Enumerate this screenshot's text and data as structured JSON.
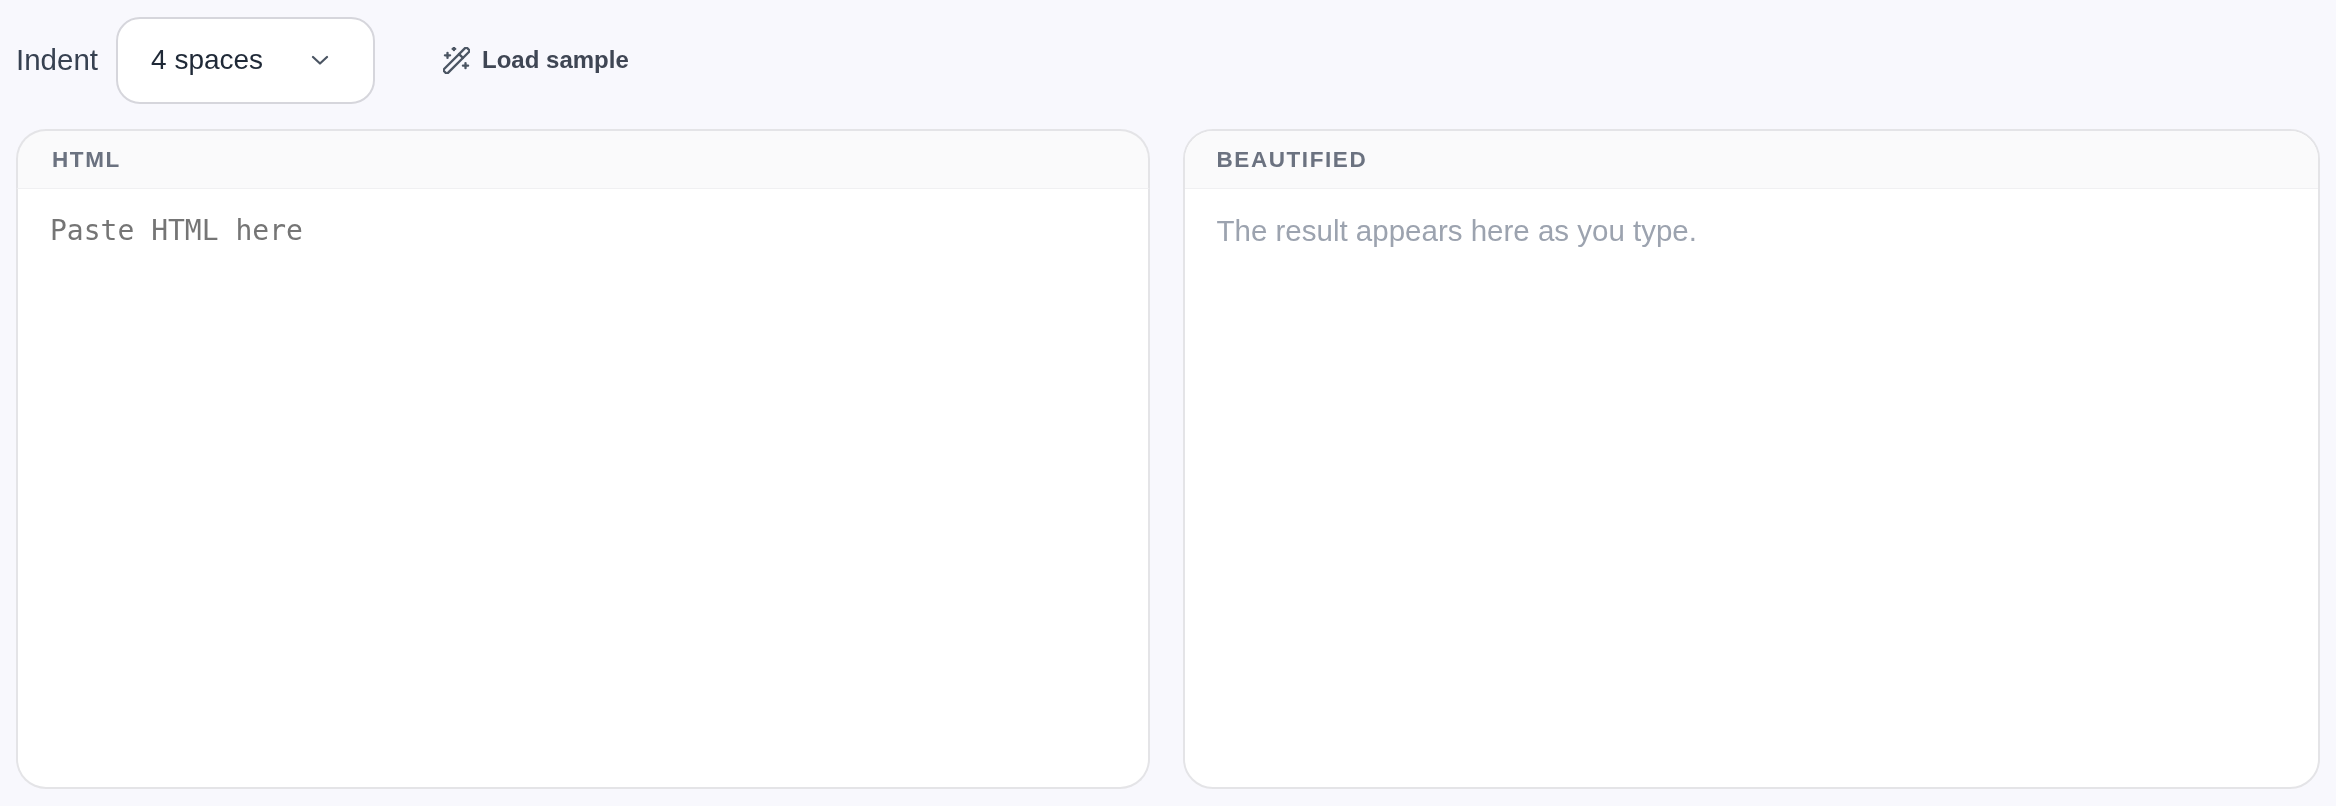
{
  "toolbar": {
    "indent": {
      "label": "Indent",
      "value": "4 spaces"
    },
    "load_sample_button": {
      "label": "Load sample"
    }
  },
  "panels": [
    {
      "kind": "input",
      "title": "HTML",
      "placeholder": "Paste HTML here"
    },
    {
      "kind": "output",
      "title": "BEAUTIFIED",
      "hint": "The result appears here as you type."
    }
  ]
}
